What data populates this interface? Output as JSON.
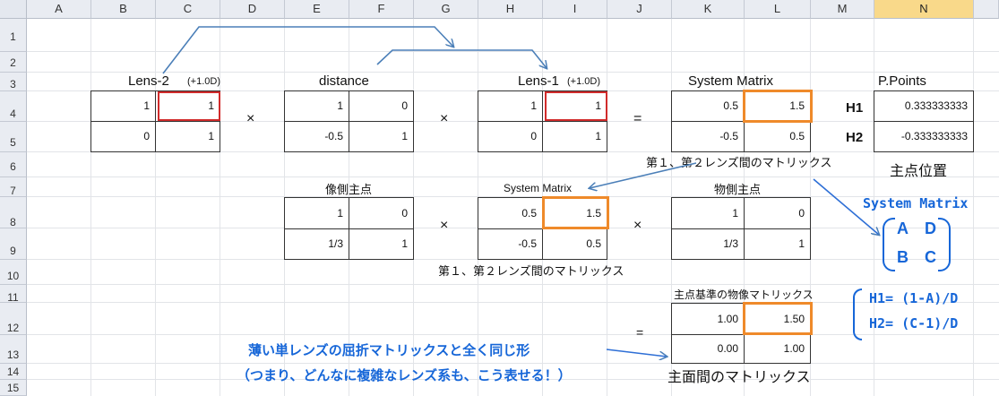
{
  "columns": [
    "A",
    "B",
    "C",
    "D",
    "E",
    "F",
    "G",
    "H",
    "I",
    "J",
    "K",
    "L",
    "M",
    "N"
  ],
  "selected_column": "N",
  "rows": [
    "1",
    "2",
    "3",
    "4",
    "5",
    "6",
    "7",
    "8",
    "9",
    "10",
    "11",
    "12",
    "13",
    "14",
    "15"
  ],
  "titles": {
    "lens2": "Lens-2",
    "lens2_power": "(+1.0D)",
    "distance": "distance",
    "lens1": "Lens-1",
    "lens1_power": "(+1.0D)",
    "system_matrix_top": "System Matrix",
    "ppoints": "P.Points",
    "image_side_pp": "像側主点",
    "system_matrix_mid": "System Matrix",
    "object_side_pp": "物側主点",
    "pp_based_matrix": "主点基準の物像マトリックス"
  },
  "operators": {
    "times1": "×",
    "times2": "×",
    "eq1": "=",
    "times3": "×",
    "times4": "×",
    "eq2": "="
  },
  "lens2": {
    "r1c1": "1",
    "r1c2": "1",
    "r2c1": "0",
    "r2c2": "1"
  },
  "distance": {
    "r1c1": "1",
    "r1c2": "0",
    "r2c1": "-0.5",
    "r2c2": "1"
  },
  "lens1": {
    "r1c1": "1",
    "r1c2": "1",
    "r2c1": "0",
    "r2c2": "1"
  },
  "system_top": {
    "r1c1": "0.5",
    "r1c2": "1.5",
    "r2c1": "-0.5",
    "r2c2": "0.5"
  },
  "ppoints": {
    "h1_label": "H1",
    "h1_value": "0.333333333",
    "h2_label": "H2",
    "h2_value": "-0.333333333"
  },
  "image_pp": {
    "r1c1": "1",
    "r1c2": "0",
    "r2c1": "1/3",
    "r2c2": "1"
  },
  "system_mid": {
    "r1c1": "0.5",
    "r1c2": "1.5",
    "r2c1": "-0.5",
    "r2c2": "0.5"
  },
  "object_pp": {
    "r1c1": "1",
    "r1c2": "0",
    "r2c1": "1/3",
    "r2c2": "1"
  },
  "pp_matrix": {
    "r1c1": "1.00",
    "r1c2": "1.50",
    "r2c1": "0.00",
    "r2c2": "1.00"
  },
  "annotations": {
    "between_lenses_top": "第１、第２レンズ間のマトリックス",
    "pp_position": "主点位置",
    "between_lenses_mid": "第１、第２レンズ間のマトリックス",
    "principal_plane_matrix": "主面間のマトリックス",
    "blue_note_line1": "薄い単レンズの屈折マトリックスと全く同じ形",
    "blue_note_line2": "（つまり、どんなに複雑なレンズ系も、こう表せる！）",
    "sm_title": "System Matrix",
    "sm_a": "A",
    "sm_d": "D",
    "sm_b": "B",
    "sm_c": "C",
    "h1_formula": "H1= (1-A)/D",
    "h2_formula": "H2= (C-1)/D"
  },
  "colors": {
    "accent_blue": "#1666d8",
    "red_highlight": "#d12b2b",
    "orange_highlight": "#ef8a2a",
    "selected_header": "#f9d98a"
  }
}
